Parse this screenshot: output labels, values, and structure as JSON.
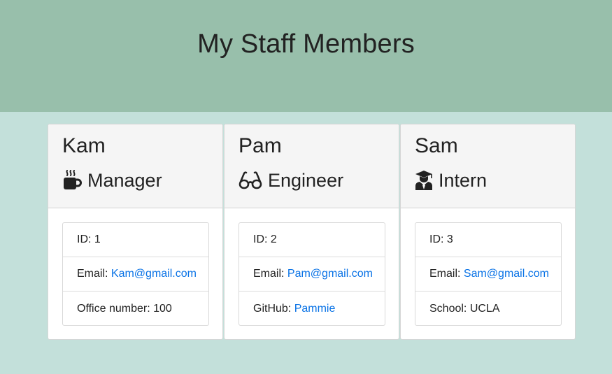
{
  "page": {
    "title": "My Staff Members"
  },
  "colors": {
    "header_bg": "#98bfab",
    "body_bg": "#c3e0da",
    "link": "#0a73e6"
  },
  "cards": [
    {
      "name": "Kam",
      "role": "Manager",
      "role_icon": "coffee-mug-icon",
      "id_label": "ID:",
      "id": "1",
      "email_label": "Email:",
      "email": "Kam@gmail.com",
      "extra_label": "Office number:",
      "extra_value": "100"
    },
    {
      "name": "Pam",
      "role": "Engineer",
      "role_icon": "glasses-icon",
      "id_label": "ID:",
      "id": "2",
      "email_label": "Email:",
      "email": "Pam@gmail.com",
      "extra_label": "GitHub:",
      "extra_value": "Pammie"
    },
    {
      "name": "Sam",
      "role": "Intern",
      "role_icon": "graduate-icon",
      "id_label": "ID:",
      "id": "3",
      "email_label": "Email:",
      "email": "Sam@gmail.com",
      "extra_label": "School:",
      "extra_value": "UCLA"
    }
  ]
}
